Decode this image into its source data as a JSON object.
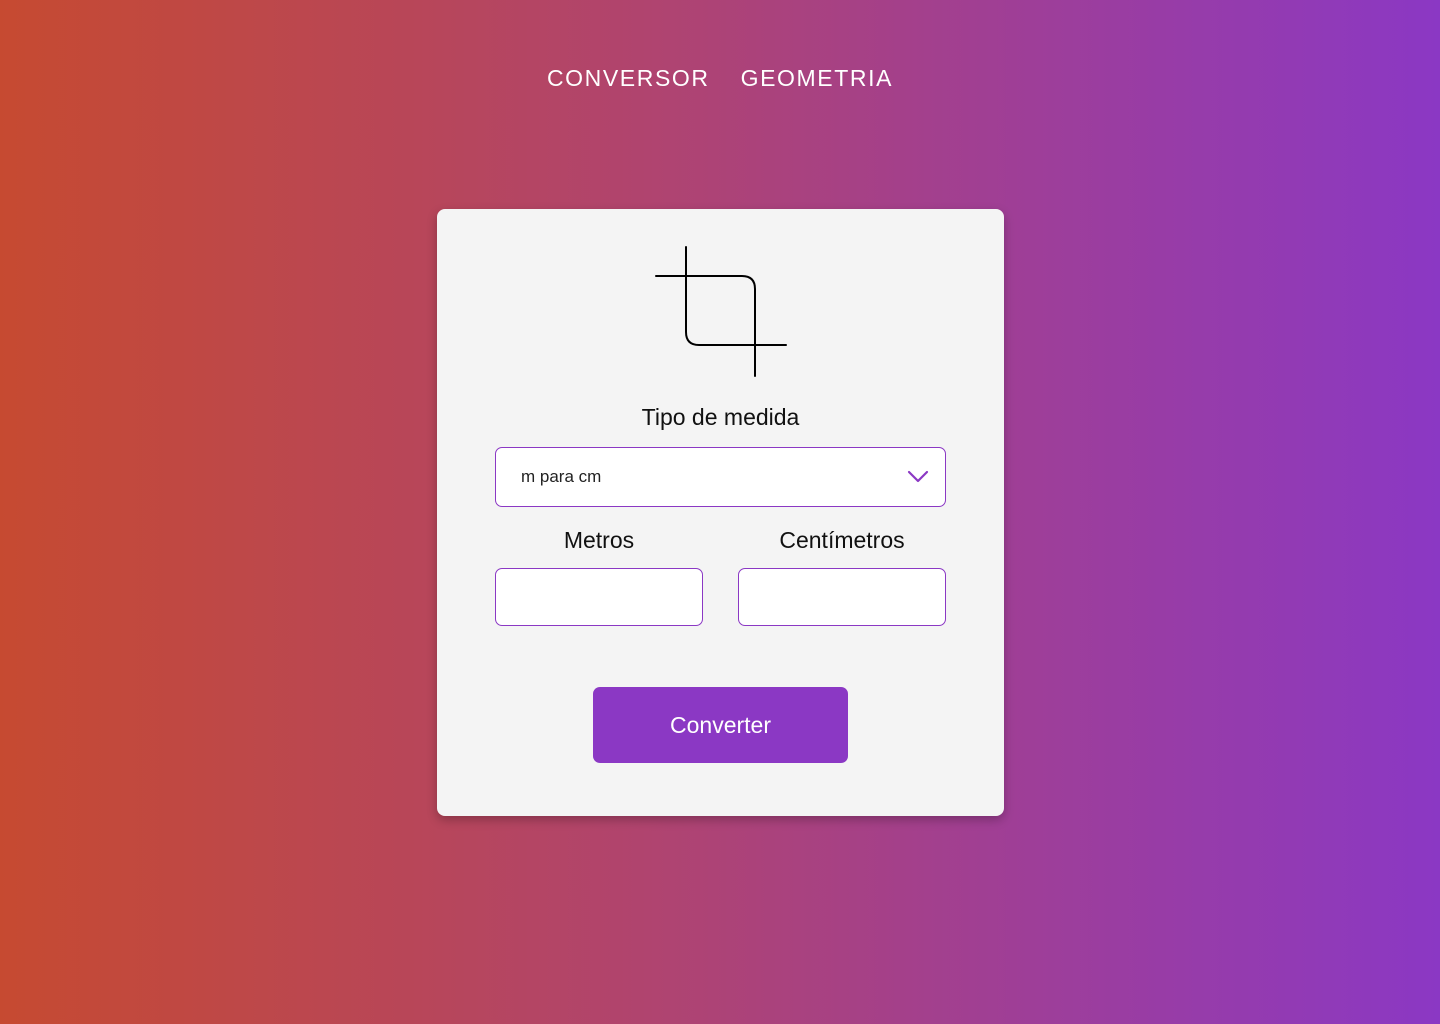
{
  "nav": {
    "items": [
      {
        "label": "CONVERSOR"
      },
      {
        "label": "GEOMETRIA"
      }
    ]
  },
  "card": {
    "icon": "crop-icon",
    "type_label": "Tipo de medida",
    "select": {
      "value": "m para cm",
      "icon": "chevron-down-icon"
    },
    "left_label": "Metros",
    "right_label": "Centímetros",
    "left_input": {
      "value": "",
      "placeholder": ""
    },
    "right_input": {
      "value": "",
      "placeholder": ""
    },
    "button_label": "Converter"
  },
  "colors": {
    "accent": "#8b38c4",
    "gradient_start": "#c64a31",
    "gradient_end": "#8b38c4",
    "card_background": "#f4f4f4"
  }
}
